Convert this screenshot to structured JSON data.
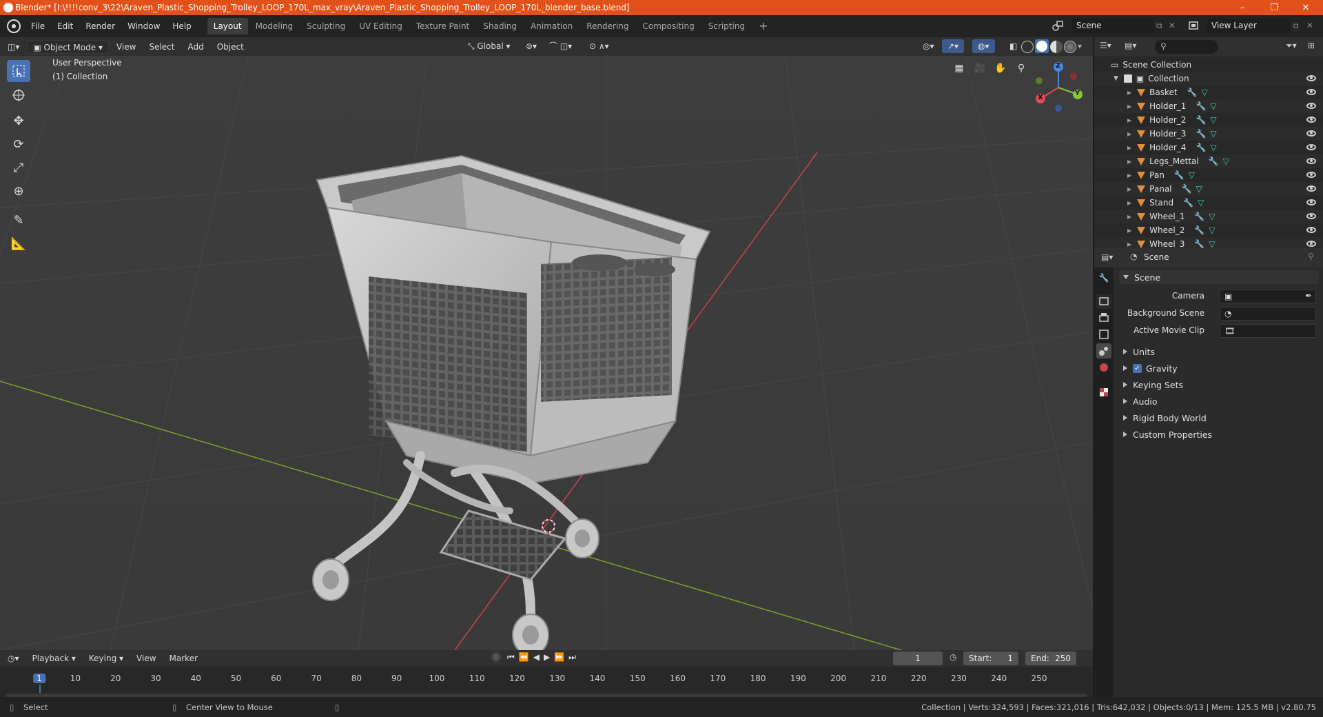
{
  "window": {
    "title": "Blender* [I:\\!!!!conv_3\\22\\Araven_Plastic_Shopping_Trolley_LOOP_170L_max_vray\\Araven_Plastic_Shopping_Trolley_LOOP_170L_blender_base.blend]",
    "controls": [
      "–",
      "❐",
      "✕"
    ]
  },
  "menu": [
    "File",
    "Edit",
    "Render",
    "Window",
    "Help"
  ],
  "workspaces": [
    "Layout",
    "Modeling",
    "Sculpting",
    "UV Editing",
    "Texture Paint",
    "Shading",
    "Animation",
    "Rendering",
    "Compositing",
    "Scripting"
  ],
  "active_workspace": "Layout",
  "scene_selector": "Scene",
  "view_layer": "View Layer",
  "viewport_header": {
    "mode": "Object Mode",
    "menus": [
      "View",
      "Select",
      "Add",
      "Object"
    ],
    "transform_orientation": "Global"
  },
  "viewport": {
    "perspective": "User Perspective",
    "collection": "(1) Collection",
    "gizmo": {
      "x": "X",
      "y": "Y",
      "z": "Z"
    }
  },
  "outliner": {
    "root": "Scene Collection",
    "collection": "Collection",
    "objects": [
      "Basket",
      "Holder_1",
      "Holder_2",
      "Holder_3",
      "Holder_4",
      "Legs_Mettal",
      "Pan",
      "Panal",
      "Stand",
      "Wheel_1",
      "Wheel_2",
      "Wheel_3"
    ]
  },
  "properties": {
    "header": "Scene",
    "panel_title": "Scene",
    "fields": [
      {
        "label": "Camera"
      },
      {
        "label": "Background Scene"
      },
      {
        "label": "Active Movie Clip"
      }
    ],
    "sections": [
      "Units",
      "Gravity",
      "Keying Sets",
      "Audio",
      "Rigid Body World",
      "Custom Properties"
    ],
    "gravity_checked": true
  },
  "timeline": {
    "menus": [
      "Playback",
      "Keying",
      "View",
      "Marker"
    ],
    "current_frame": "1",
    "start_label": "Start:",
    "start": "1",
    "end_label": "End:",
    "end": "250",
    "ticks": [
      "1",
      "10",
      "20",
      "30",
      "40",
      "50",
      "60",
      "70",
      "80",
      "90",
      "100",
      "110",
      "120",
      "130",
      "140",
      "150",
      "160",
      "170",
      "180",
      "190",
      "200",
      "210",
      "220",
      "230",
      "240",
      "250"
    ]
  },
  "statusbar": {
    "left": "Select",
    "middle": "Center View to Mouse",
    "right": "Collection | Verts:324,593 | Faces:321,016 | Tris:642,032 | Objects:0/13 | Mem: 125.5 MB | v2.80.75"
  },
  "colors": {
    "title_bar": "#e3511b",
    "accent": "#4772b3",
    "x_axis": "#e04a5a",
    "y_axis": "#8ac43c",
    "z_axis": "#4b86e0",
    "object_icon": "#e08e39"
  }
}
